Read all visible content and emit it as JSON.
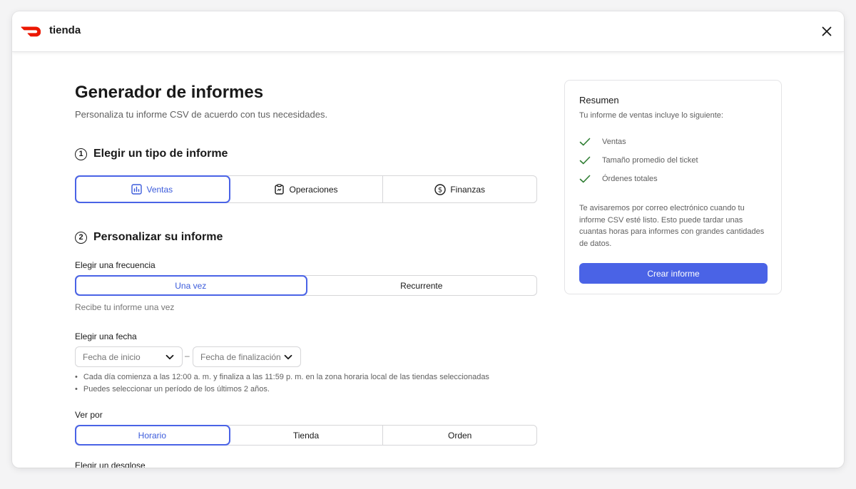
{
  "app": {
    "store_name": "tienda"
  },
  "header": {
    "title": "Generador de informes",
    "subtitle": "Personaliza tu informe CSV de acuerdo con tus necesidades."
  },
  "step1": {
    "number": "1",
    "heading": "Elegir un tipo de informe",
    "options": [
      {
        "label": "Ventas",
        "icon": "bar-chart-icon",
        "selected": true
      },
      {
        "label": "Operaciones",
        "icon": "clipboard-icon",
        "selected": false
      },
      {
        "label": "Finanzas",
        "icon": "dollar-circle-icon",
        "selected": false
      }
    ]
  },
  "step2": {
    "number": "2",
    "heading": "Personalizar su informe",
    "frequency": {
      "label": "Elegir una frecuencia",
      "options": [
        {
          "label": "Una vez",
          "selected": true
        },
        {
          "label": "Recurrente",
          "selected": false
        }
      ],
      "hint": "Recibe tu informe una vez"
    },
    "date": {
      "label": "Elegir una fecha",
      "start_placeholder": "Fecha de inicio",
      "separator": "–",
      "end_placeholder": "Fecha de finalización",
      "notes": [
        "Cada día comienza a las 12:00 a. m. y finaliza a las 11:59 p. m. en la zona horaria local de las tiendas seleccionadas",
        "Puedes seleccionar un período de los últimos 2 años."
      ]
    },
    "view_by": {
      "label": "Ver por",
      "options": [
        {
          "label": "Horario",
          "selected": true
        },
        {
          "label": "Tienda",
          "selected": false
        },
        {
          "label": "Orden",
          "selected": false
        }
      ]
    },
    "breakdown": {
      "label": "Elegir un desglose"
    }
  },
  "summary": {
    "title": "Resumen",
    "description": "Tu informe de ventas incluye lo siguiente:",
    "items": [
      "Ventas",
      "Tamaño promedio del ticket",
      "Órdenes totales"
    ],
    "note": "Te avisaremos por correo electrónico cuando tu informe CSV esté listo. Esto puede tardar unas cuantas horas para informes con grandes cantidades de datos.",
    "button_label": "Crear informe"
  },
  "colors": {
    "accent": "#4a63e6",
    "brand": "#eb1700",
    "check": "#2e7d32"
  }
}
